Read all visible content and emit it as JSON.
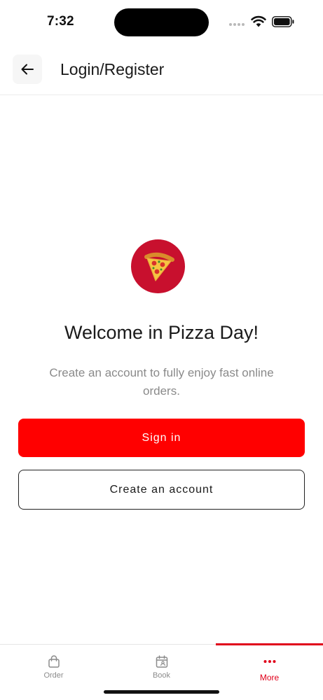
{
  "status_bar": {
    "time": "7:32",
    "icons": [
      "signal-dots-icon",
      "wifi-icon",
      "battery-icon"
    ]
  },
  "header": {
    "back_icon": "arrow-left-icon",
    "title": "Login/Register"
  },
  "main": {
    "logo_icon": "pizza-slice-icon",
    "welcome_title": "Welcome in Pizza Day!",
    "subtitle": "Create an account to fully enjoy fast online orders.",
    "sign_in_label": "Sign in",
    "create_account_label": "Create an account"
  },
  "tab_bar": {
    "active": "More",
    "tabs": [
      {
        "label": "Order",
        "icon": "shopping-bag-icon"
      },
      {
        "label": "Book",
        "icon": "calendar-user-icon"
      },
      {
        "label": "More",
        "icon": "more-dots-icon"
      }
    ]
  },
  "colors": {
    "accent": "#ff0000",
    "logo_background": "#c8102e",
    "active_tab": "#e0001a",
    "inactive_tab": "#8c8c8c",
    "subtitle_text": "#8a8a8a"
  }
}
